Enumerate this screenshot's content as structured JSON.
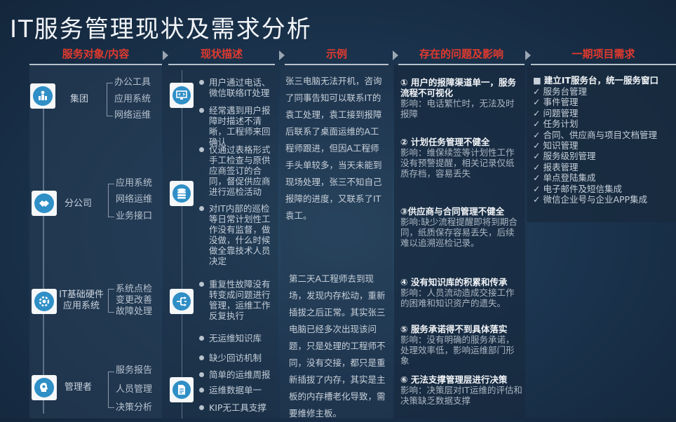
{
  "title": "IT服务管理现状及需求分析",
  "headers": [
    "服务对象/内容",
    "现状描述",
    "示例",
    "存在的问题及影响",
    "一期项目需求"
  ],
  "objects": [
    {
      "name": "集团",
      "items": [
        "办公工具",
        "应用系统",
        "网络运维"
      ],
      "icon": "building-people-icon"
    },
    {
      "name": "分公司",
      "items": [
        "应用系统",
        "网络运维",
        "业务接口"
      ],
      "icon": "handshake-icon"
    },
    {
      "name": "IT基础硬件\n应用系统",
      "items": [
        "系统点检",
        "变更改善",
        "故障处理"
      ],
      "icon": "gear-icon"
    },
    {
      "name": "管理者",
      "items": [
        "服务报告",
        "人员管理",
        "决策分析"
      ],
      "icon": "head-lightbulb-icon"
    }
  ],
  "status_icons": [
    "code-monitor-icon",
    "database-icon",
    "network-flow-icon",
    "document-icon"
  ],
  "status": [
    "用户通过电话、微信联络IT处理",
    "经常遇到用户报障时描述不清晰，工程师来回确认",
    "仅通过表格形式手工检查与原供应商签订的合同，督促供应商进行巡检活动",
    "对IT内部的巡检等日常计划性工作没有监督，做没做，什么时候做全靠技术人员决定",
    "重复性故障没有转变成问题进行管理，运维工作反复执行",
    "无运维知识库",
    "缺少回访机制",
    "简单的运维周报",
    "运维数据单一",
    "KIP无工具支撑"
  ],
  "examples": [
    "张三电脑无法开机，咨询了同事告知可以联系IT的袁工处理，袁工接到报障后联系了桌面运维的A工程师跟进，但因A工程师手头单较多，当天未能到现场处理，张三不知自己报障的进度，又联系了IT袁工。",
    "第二天A工程师去到现场，发现内存松动，重新插拔之后正常。其实张三电脑已经多次出现该问题，只是处理的工程师不同，没有交接，都只是重新插拔了内存，其实是主板的内存槽老化导致，需要维修主板。"
  ],
  "issues": [
    {
      "title": "① 用户的报障渠道单一，服务流程不可视化",
      "detail": "影响：电话繁忙时，无法及时报障"
    },
    {
      "title": "② 计划任务管理不健全",
      "detail": "影响：维保续签等计划性工作没有预警提醒，相关记录仅纸质存档，容易丢失"
    },
    {
      "title": "③供应商与合同管理不健全",
      "detail": "影响:缺少流程提醒即将到期合同，纸质保存容易丢失，后续难以追溯巡检记录。"
    },
    {
      "title": "④ 没有知识库的积累和传承",
      "detail": "影响：人员流动造成交接工作的困难和知识资产的遗失。"
    },
    {
      "title": "⑤ 服务承诺得不到具体落实",
      "detail": "影响：没有明确的服务承诺，处理效率低，影响运维部门形象"
    },
    {
      "title": "⑥ 无法支撑管理层进行决策",
      "detail": "影响：决策层对IT运维的评估和决策缺乏数据支撑"
    }
  ],
  "requirements": {
    "heading": "建立IT服务台，统一服务窗口",
    "items": [
      "服务台管理",
      "事件管理",
      "问题管理",
      "任务计划",
      "合同、供应商与项目文档管理",
      "知识管理",
      "服务级别管理",
      "报表管理",
      "单点登陆集成",
      "电子邮件及短信集成",
      "微信企业号与企业APP集成"
    ]
  },
  "colors": {
    "header_red": "#e23a2e",
    "icon_blue": "#2f8fc6",
    "background": "#1c3550"
  }
}
